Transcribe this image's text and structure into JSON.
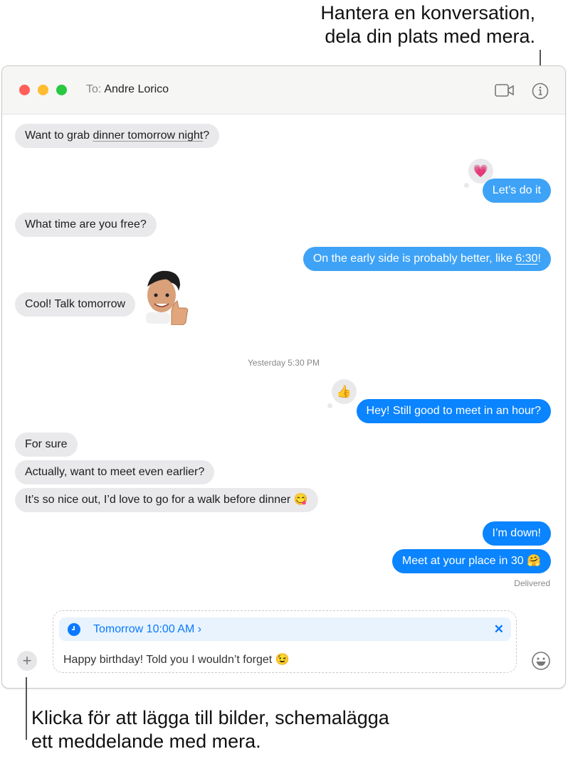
{
  "callouts": {
    "top": [
      "Hantera en konversation,",
      "dela din plats med mera."
    ],
    "bottom": [
      "Klicka för att lägga till bilder, schemalägga",
      "ett meddelande med mera."
    ]
  },
  "header": {
    "to_label": "To:",
    "recipient": "Andre Lorico",
    "icons": [
      "video-camera-icon",
      "info-icon"
    ]
  },
  "colors": {
    "incoming": "#e9e9eb",
    "outgoing": "#0a84ff",
    "outgoing_light": "#3ea3f7",
    "close": "#ff5f57",
    "minimize": "#febc2e",
    "zoom": "#28c840"
  },
  "messages": [
    {
      "dir": "in",
      "pre": "Want to grab ",
      "link": "dinner tomorrow night",
      "post": "?"
    },
    {
      "dir": "out",
      "text": "Let’s do it",
      "tapback": "💗"
    },
    {
      "dir": "in",
      "text": "What time are you free?"
    },
    {
      "dir": "out",
      "pre": "On the early side is probably better, like ",
      "link": "6:30",
      "post": "!"
    },
    {
      "dir": "in",
      "text": "Cool! Talk tomorrow",
      "sticker": "memoji-thumbs-up"
    },
    {
      "dir": "out",
      "text": "Hey! Still good to meet in an hour?",
      "tapback": "👍"
    },
    {
      "dir": "in",
      "text": "For sure"
    },
    {
      "dir": "in",
      "text": "Actually, want to meet even earlier?"
    },
    {
      "dir": "in",
      "text": "It’s so nice out, I’d love to go for a walk before dinner 😋"
    },
    {
      "dir": "out",
      "text": "I’m down!"
    },
    {
      "dir": "out",
      "text": "Meet at your place in 30 🤗"
    }
  ],
  "timestamp": "Yesterday 5:30 PM",
  "status": "Delivered",
  "compose": {
    "schedule": "Tomorrow 10:00 AM",
    "schedule_chevron": "›",
    "close": "✕",
    "text": "Happy birthday! Told you I wouldn’t forget 😉"
  }
}
